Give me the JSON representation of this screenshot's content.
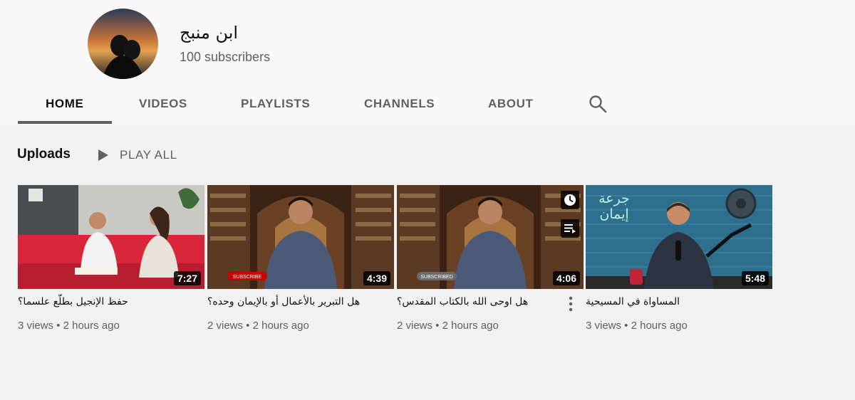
{
  "channel": {
    "name": "ابن منبج",
    "subscribers": "100 subscribers"
  },
  "tabs": [
    {
      "label": "HOME",
      "active": true
    },
    {
      "label": "VIDEOS",
      "active": false
    },
    {
      "label": "PLAYLISTS",
      "active": false
    },
    {
      "label": "CHANNELS",
      "active": false
    },
    {
      "label": "ABOUT",
      "active": false
    }
  ],
  "uploads": {
    "title": "Uploads",
    "play_all": "PLAY ALL"
  },
  "videos": [
    {
      "title": "حفظ الإنجيل بطلّع علسما؟",
      "duration": "7:27",
      "meta": "3 views • 2 hours ago"
    },
    {
      "title": "هل التبرير بالأعمال أو بالإيمان وحده؟",
      "duration": "4:39",
      "meta": "2 views • 2 hours ago",
      "thumb_badge": "SUBSCRIBE"
    },
    {
      "title": "هل اوحى الله بالكتاب المقدس؟",
      "duration": "4:06",
      "meta": "2 views • 2 hours ago",
      "thumb_badge": "SUBSCRIBED"
    },
    {
      "title": "المساواة في المسيحية",
      "duration": "5:48",
      "meta": "3 views • 2 hours ago",
      "thumb_caption": "جرعة إيمان"
    }
  ],
  "icons": {
    "search": "search-icon",
    "play": "play-icon",
    "watch_later": "clock-icon",
    "add_to_queue": "queue-icon",
    "more": "more-vert-icon"
  },
  "colors": {
    "header_bg": "#f9f9f9",
    "page_bg": "#f1f1f1",
    "subscribe_red": "#cc0000"
  }
}
